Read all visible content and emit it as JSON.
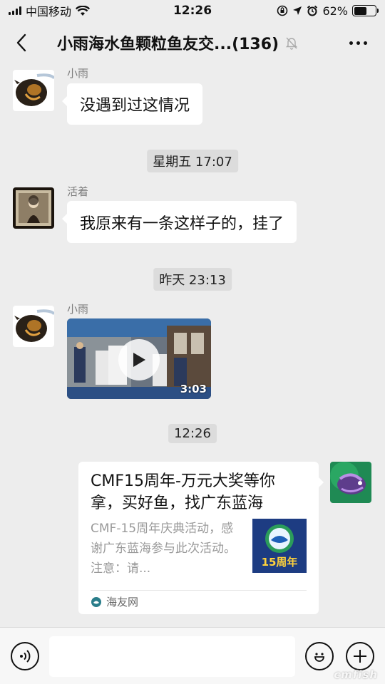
{
  "status_bar": {
    "carrier": "中国移动",
    "time": "12:26",
    "battery_percent": "62%",
    "battery_level": 0.62,
    "icons": [
      "signal-icon",
      "wifi-icon",
      "rotation-lock-icon",
      "location-icon",
      "alarm-icon",
      "battery-icon"
    ]
  },
  "header": {
    "title": "小雨海水鱼颗粒鱼友交...(136)",
    "back_icon": "chevron-left-icon",
    "mute_icon": "bell-muted-icon",
    "more_icon": "more-dots-icon"
  },
  "messages": [
    {
      "kind": "text",
      "sender": "小雨",
      "text": "没遇到过这情况"
    },
    {
      "kind": "time",
      "text": "星期五 17:07"
    },
    {
      "kind": "text",
      "sender": "活着",
      "text": "我原来有一条这样子的，挂了"
    },
    {
      "kind": "time",
      "text": "昨天 23:13"
    },
    {
      "kind": "video",
      "sender": "小雨",
      "duration": "3:03"
    },
    {
      "kind": "time",
      "text": "12:26"
    },
    {
      "kind": "link",
      "title": "CMF15周年-万元大奖等你拿，买好鱼，找广东蓝海",
      "description": "CMF-15周年庆典活动，感谢广东蓝海参与此次活动。注意：请...",
      "thumb_badge": "15周年",
      "source": "海友网"
    }
  ],
  "input_bar": {
    "placeholder": "",
    "voice_icon": "voice-icon",
    "emoji_icon": "emoji-icon",
    "plus_icon": "plus-icon"
  },
  "watermark": "cmfish",
  "colors": {
    "background": "#ededed",
    "bubble": "#ffffff",
    "time_chip": "#dcdcdc",
    "sender_name": "#7d7d7d",
    "link_description": "#999999"
  }
}
